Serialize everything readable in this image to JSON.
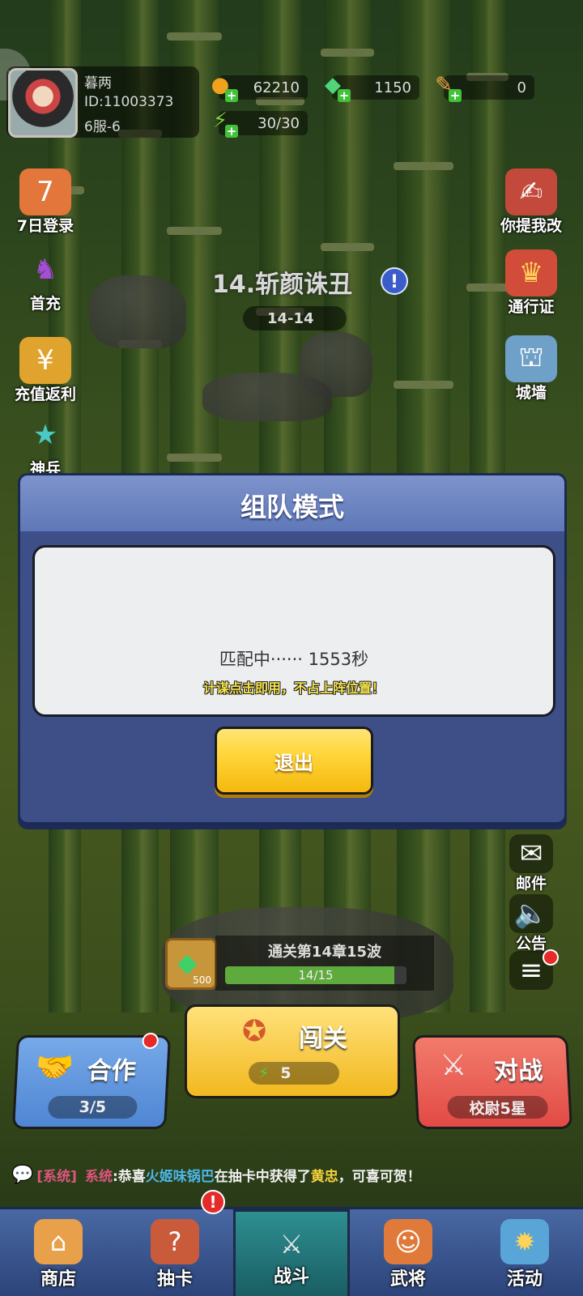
{
  "player": {
    "name": "暮两",
    "id": "ID:11003373",
    "server": "6服-6"
  },
  "resources": {
    "gold": "62210",
    "gems": "1150",
    "feathers": "0",
    "energy": "30/30"
  },
  "side_left": [
    "7日登录",
    "首充",
    "充值返利",
    "神兵"
  ],
  "side_right": [
    "你提我改",
    "通行证",
    "城墙",
    "邮件",
    "公告"
  ],
  "stage": {
    "title": "14.斩颜诛丑",
    "level": "14-14"
  },
  "dialog": {
    "title": "组队模式",
    "matching": "匹配中······ 1553秒",
    "tip": "计谋点击即用，不占上阵位置！",
    "exit_label": "退出"
  },
  "progress": {
    "reward": "500",
    "title": "通关第14章15波",
    "text": "14/15",
    "fraction": 0.9333
  },
  "modes": {
    "coop": {
      "label": "合作",
      "sub": "3/5"
    },
    "challenge": {
      "label": "闯关",
      "sub": "5"
    },
    "battle": {
      "label": "对战",
      "sub": "校尉5星"
    }
  },
  "chat": {
    "channel": "[系统]",
    "sender": "系统",
    "pre": ":恭喜",
    "player": "火姬味锅巴",
    "mid": "在抽卡中获得了",
    "hero": "黄忠",
    "post": "，可喜可贺！"
  },
  "nav": [
    "商店",
    "抽卡",
    "战斗",
    "武将",
    "活动"
  ],
  "colors": {
    "accent_yellow": "#ffd63a",
    "dialog_blue": "#3d4f86",
    "coop_blue": "#4f86d4",
    "battle_red": "#e24a45"
  }
}
